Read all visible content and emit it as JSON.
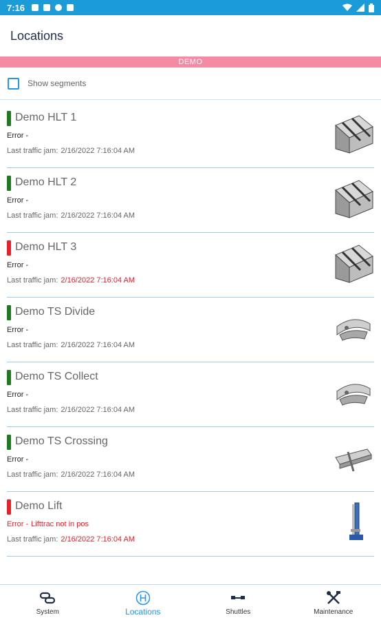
{
  "status_bar": {
    "time": "7:16"
  },
  "app": {
    "title": "Locations",
    "demo_banner": "DEMO"
  },
  "segments": {
    "label": "Show segments",
    "checked": false
  },
  "colors": {
    "ok": "#1e7a1e",
    "error": "#e8202a",
    "accent": "#2196f3",
    "banner": "#f48aa4"
  },
  "locations": [
    {
      "name": "Demo HLT 1",
      "status": "ok",
      "error_label": "Error -",
      "error_msg": "",
      "jam_label": "Last traffic jam:",
      "jam_value": "2/16/2022 7:16:04 AM",
      "jam_alert": false,
      "thumb": "hlt"
    },
    {
      "name": "Demo HLT 2",
      "status": "ok",
      "error_label": "Error -",
      "error_msg": "",
      "jam_label": "Last traffic jam:",
      "jam_value": "2/16/2022 7:16:04 AM",
      "jam_alert": false,
      "thumb": "hlt"
    },
    {
      "name": "Demo HLT 3",
      "status": "error",
      "error_label": "Error -",
      "error_msg": "",
      "jam_label": "Last traffic jam:",
      "jam_value": "2/16/2022 7:16:04 AM",
      "jam_alert": true,
      "thumb": "hlt"
    },
    {
      "name": "Demo TS Divide",
      "status": "ok",
      "error_label": "Error -",
      "error_msg": "",
      "jam_label": "Last traffic jam:",
      "jam_value": "2/16/2022 7:16:04 AM",
      "jam_alert": false,
      "thumb": "ts"
    },
    {
      "name": "Demo TS Collect",
      "status": "ok",
      "error_label": "Error -",
      "error_msg": "",
      "jam_label": "Last traffic jam:",
      "jam_value": "2/16/2022 7:16:04 AM",
      "jam_alert": false,
      "thumb": "ts"
    },
    {
      "name": "Demo TS Crossing",
      "status": "ok",
      "error_label": "Error -",
      "error_msg": "",
      "jam_label": "Last traffic jam:",
      "jam_value": "2/16/2022 7:16:04 AM",
      "jam_alert": false,
      "thumb": "crossing"
    },
    {
      "name": "Demo Lift",
      "status": "error",
      "error_label": "Error -",
      "error_msg": "Lifttrac not in pos",
      "jam_label": "Last traffic jam:",
      "jam_value": "2/16/2022 7:16:04 AM",
      "jam_alert": true,
      "thumb": "lift"
    }
  ],
  "nav": [
    {
      "label": "System",
      "icon": "link-icon",
      "active": false
    },
    {
      "label": "Locations",
      "icon": "h-circle-icon",
      "active": true
    },
    {
      "label": "Shuttles",
      "icon": "shuttle-icon",
      "active": false
    },
    {
      "label": "Maintenance",
      "icon": "tools-icon",
      "active": false
    }
  ]
}
